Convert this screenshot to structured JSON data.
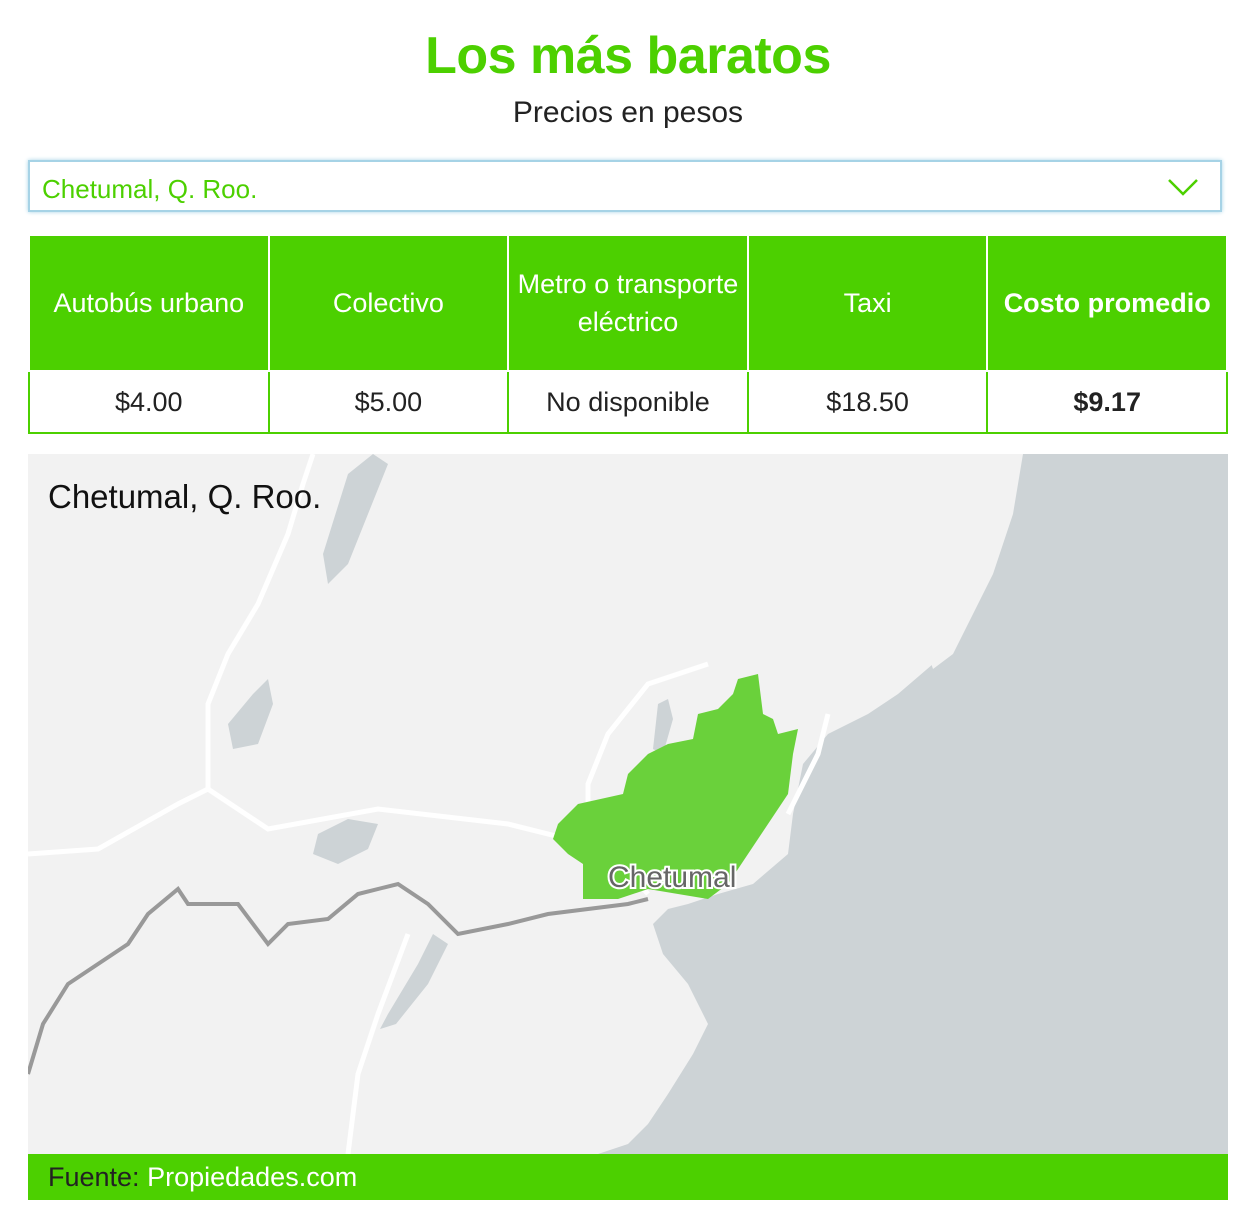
{
  "header": {
    "title": "Los más baratos",
    "subtitle": "Precios en pesos"
  },
  "city_select": {
    "selected": "Chetumal, Q. Roo."
  },
  "table": {
    "columns": [
      "Autobús urbano",
      "Colectivo",
      "Metro o transporte eléctrico",
      "Taxi",
      "Costo promedio"
    ],
    "values": [
      "$4.00",
      "$5.00",
      "No disponible",
      "$18.50",
      "$9.17"
    ]
  },
  "map": {
    "title": "Chetumal, Q. Roo.",
    "city_label": "Chetumal",
    "colors": {
      "land": "#f2f2f2",
      "water": "#cdd3d6",
      "urban": "#6ad13b",
      "road": "#ffffff",
      "border": "#999999"
    }
  },
  "source": {
    "label": "Fuente:",
    "value": "Propiedades.com"
  },
  "colors": {
    "accent": "#4cd000",
    "focus_border": "#a6d3e6"
  }
}
